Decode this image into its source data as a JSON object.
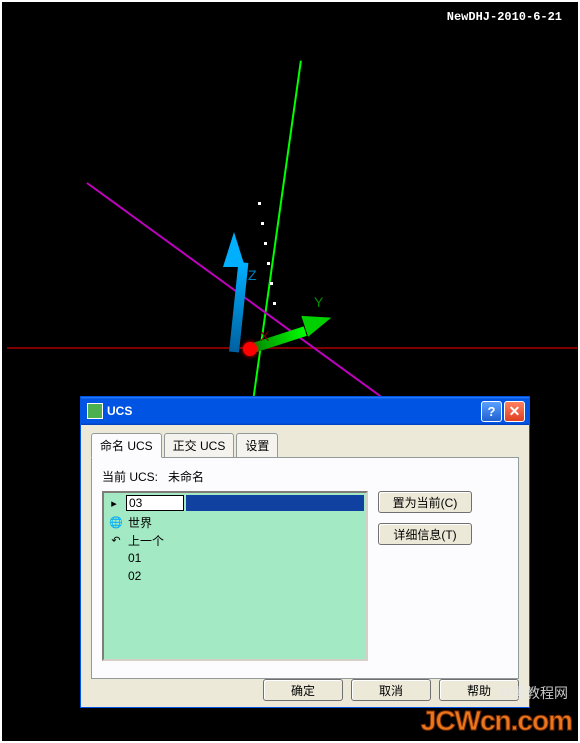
{
  "viewport": {
    "date_label": "NewDHJ-2010-6-21",
    "axis_labels": {
      "z": "Z",
      "y": "Y",
      "x": "X"
    }
  },
  "dialog": {
    "title": "UCS",
    "tabs": [
      {
        "label": "命名 UCS",
        "active": true
      },
      {
        "label": "正交 UCS",
        "active": false
      },
      {
        "label": "设置",
        "active": false
      }
    ],
    "current_label_prefix": "当前 UCS:",
    "current_ucs_value": "未命名",
    "editing_value": "03",
    "list_items": [
      {
        "icon": "globe",
        "label": "世界"
      },
      {
        "icon": "prev",
        "label": "上一个"
      },
      {
        "icon": "",
        "label": "01"
      },
      {
        "icon": "",
        "label": "02"
      }
    ],
    "side_buttons": {
      "set_current": "置为当前(C)",
      "details": "详细信息(T)"
    },
    "bottom_buttons": {
      "ok": "确定",
      "cancel": "取消",
      "help": "帮助"
    }
  },
  "watermark": {
    "cn": "中国教程网",
    "jcw": "JCWcn.com"
  }
}
